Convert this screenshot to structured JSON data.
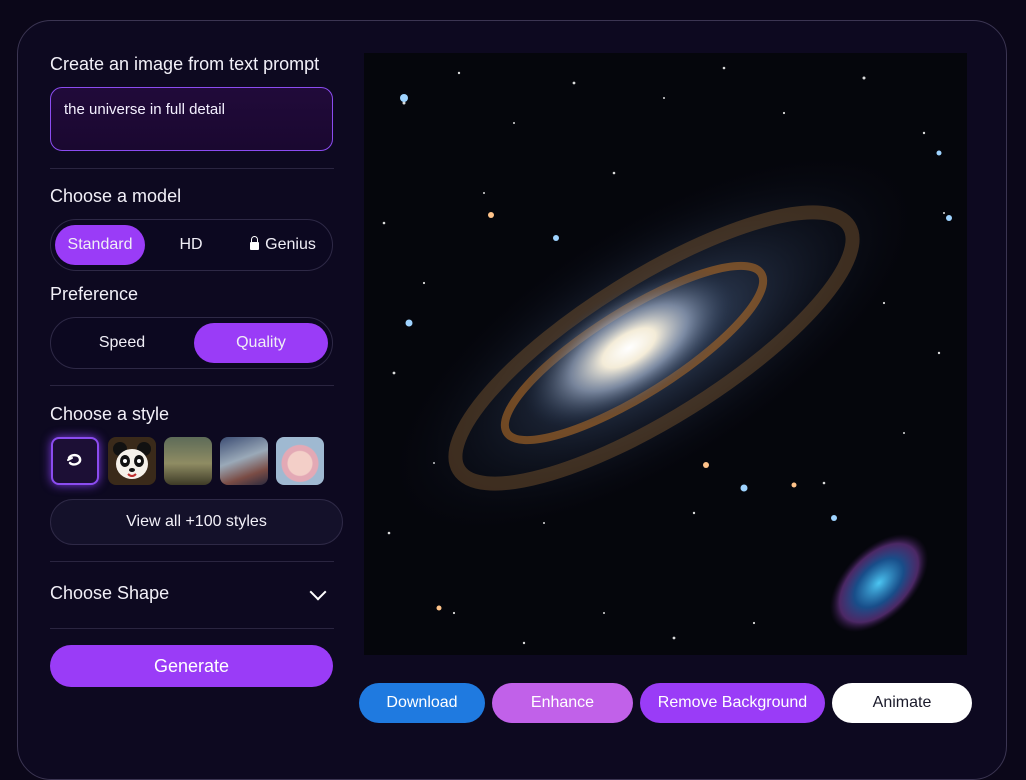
{
  "prompt_section": {
    "title": "Create an image from text prompt",
    "value": "the universe in full detail"
  },
  "model_section": {
    "title": "Choose a model",
    "options": [
      "Standard",
      "HD",
      "Genius"
    ],
    "selected": "Standard"
  },
  "preference_section": {
    "title": "Preference",
    "options": [
      "Speed",
      "Quality"
    ],
    "selected": "Quality"
  },
  "style_section": {
    "title": "Choose a style",
    "thumbnails": [
      "no-style-icon",
      "panda-style",
      "forest-style",
      "robot-style",
      "anime-girl-style"
    ],
    "view_all_label": "View all +100 styles"
  },
  "shape_section": {
    "title": "Choose Shape"
  },
  "generate_label": "Generate",
  "actions": {
    "download": "Download",
    "enhance": "Enhance",
    "remove_background": "Remove Background",
    "animate": "Animate"
  },
  "colors": {
    "accent": "#9a3cf7",
    "download": "#1f7ae0",
    "enhance": "#c161e9",
    "remove_bg": "#9a3cf7",
    "animate": "#ffffff",
    "background": "#0b0719"
  }
}
